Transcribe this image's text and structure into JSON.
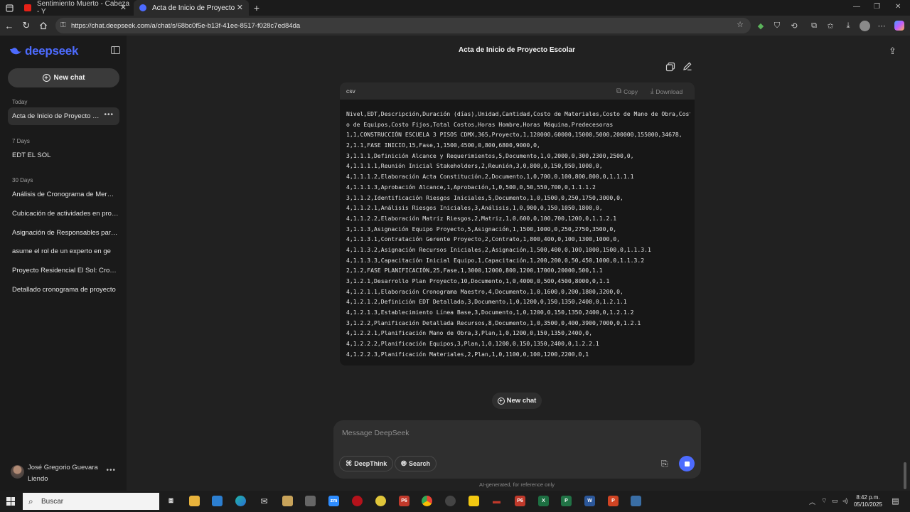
{
  "browser": {
    "tabs": [
      {
        "label": "Sentimiento Muerto - Cabeza - Y",
        "favicon_color": "#e62117"
      },
      {
        "label": "Acta de Inicio de Proyecto Escolar",
        "favicon_color": "#4d6bfe"
      }
    ],
    "url": "https://chat.deepseek.com/a/chat/s/68bc0f5e-b13f-41ee-8517-f028c7ed84da"
  },
  "sidebar": {
    "logo": "deepseek",
    "new_chat": "New chat",
    "sections": [
      {
        "title": "Today",
        "items": [
          "Acta de Inicio de Proyecto Escolar"
        ]
      },
      {
        "title": "7 Days",
        "items": [
          "EDT EL SOL"
        ]
      },
      {
        "title": "30 Days",
        "items": [
          "Análisis de Cronograma de Mermas",
          "Cubicación de actividades en proyecto",
          "Asignación de Responsables para proyecto",
          "asume el rol de un experto en ge",
          "Proyecto Residencial El Sol: Cronograma",
          "Detallado cronograma de proyecto"
        ]
      }
    ],
    "user_name": "José Gregorio Guevara Liendo"
  },
  "chat": {
    "title": "Acta de Inicio de Proyecto Escolar",
    "code": {
      "lang": "csv",
      "copy_label": "Copy",
      "download_label": "Download",
      "lines": [
        "Nivel,EDT,Descripción,Duración (días),Unidad,Cantidad,Costo de Materiales,Costo de Mano de Obra,Cost",
        "o de Equipos,Costo Fijos,Total Costos,Horas Hombre,Horas Máquina,Predecesoras",
        "1,1,CONSTRUCCIÓN ESCUELA 3 PISOS CDMX,365,Proyecto,1,120000,60000,15000,5000,200000,155000,34678,",
        "2,1.1,FASE INICIO,15,Fase,1,1500,4500,0,800,6800,9000,0,",
        "3,1.1.1,Definición Alcance y Requerimientos,5,Documento,1,0,2000,0,300,2300,2500,0,",
        "4,1.1.1.1,Reunión Inicial Stakeholders,2,Reunión,3,0,800,0,150,950,1000,0,",
        "4,1.1.1.2,Elaboración Acta Constitución,2,Documento,1,0,700,0,100,800,800,0,1.1.1.1",
        "4,1.1.1.3,Aprobación Alcance,1,Aprobación,1,0,500,0,50,550,700,0,1.1.1.2",
        "3,1.1.2,Identificación Riesgos Iniciales,5,Documento,1,0,1500,0,250,1750,3000,0,",
        "4,1.1.2.1,Análisis Riesgos Iniciales,3,Análisis,1,0,900,0,150,1050,1800,0,",
        "4,1.1.2.2,Elaboración Matriz Riesgos,2,Matriz,1,0,600,0,100,700,1200,0,1.1.2.1",
        "3,1.1.3,Asignación Equipo Proyecto,5,Asignación,1,1500,1000,0,250,2750,3500,0,",
        "4,1.1.3.1,Contratación Gerente Proyecto,2,Contrato,1,800,400,0,100,1300,1000,0,",
        "4,1.1.3.2,Asignación Recursos Iniciales,2,Asignación,1,500,400,0,100,1000,1500,0,1.1.3.1",
        "4,1.1.3.3,Capacitación Inicial Equipo,1,Capacitación,1,200,200,0,50,450,1000,0,1.1.3.2",
        "2,1.2,FASE PLANIFICACIÓN,25,Fase,1,3000,12000,800,1200,17000,20000,500,1.1",
        "3,1.2.1,Desarrollo Plan Proyecto,10,Documento,1,0,4000,0,500,4500,8000,0,1.1",
        "4,1.2.1.1,Elaboración Cronograma Maestro,4,Documento,1,0,1600,0,200,1800,3200,0,",
        "4,1.2.1.2,Definición EDT Detallada,3,Documento,1,0,1200,0,150,1350,2400,0,1.2.1.1",
        "4,1.2.1.3,Establecimiento Línea Base,3,Documento,1,0,1200,0,150,1350,2400,0,1.2.1.2",
        "3,1.2.2,Planificación Detallada Recursos,8,Documento,1,0,3500,0,400,3900,7000,0,1.2.1",
        "4,1.2.2.1,Planificación Mano de Obra,3,Plan,1,0,1200,0,150,1350,2400,0,",
        "4,1.2.2.2,Planificación Equipos,3,Plan,1,0,1200,0,150,1350,2400,0,1.2.2.1",
        "4,1.2.2.3,Planificación Materiales,2,Plan,1,0,1100,0,100,1200,2200,0,1"
      ]
    },
    "new_chat_button": "New chat",
    "composer": {
      "placeholder": "Message DeepSeek",
      "deepthink_label": "DeepThink",
      "search_label": "Search"
    },
    "disclaimer": "AI-generated, for reference only"
  },
  "taskbar": {
    "search_placeholder": "Buscar",
    "time": "8:42 p.m.",
    "date": "05/10/2025"
  }
}
